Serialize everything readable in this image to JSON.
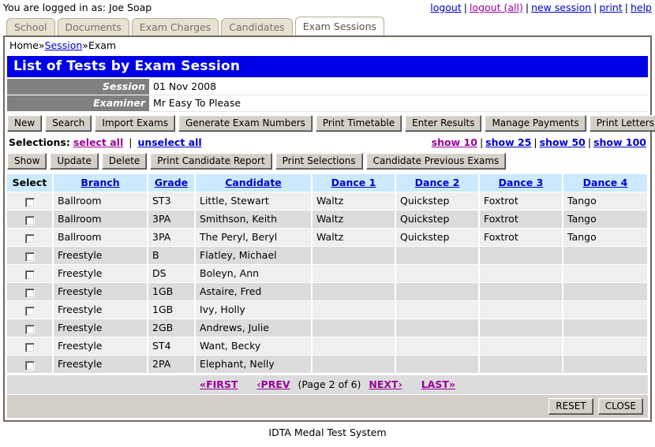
{
  "topbar": {
    "logged_in_text": "You are logged in as: Joe Soap",
    "links": [
      {
        "label": "logout",
        "visited": false
      },
      {
        "label": "logout (all)",
        "visited": true
      },
      {
        "label": "new session",
        "visited": false
      },
      {
        "label": "print",
        "visited": false
      },
      {
        "label": "help",
        "visited": false
      }
    ],
    "separator": "|"
  },
  "tabs": [
    {
      "label": "School",
      "active": false
    },
    {
      "label": "Documents",
      "active": false
    },
    {
      "label": "Exam Charges",
      "active": false
    },
    {
      "label": "Candidates",
      "active": false
    },
    {
      "label": "Exam Sessions",
      "active": true
    }
  ],
  "breadcrumb": {
    "home": "Home",
    "sep1": "»",
    "session": "Session",
    "sep2": "»",
    "exam": "Exam"
  },
  "page_title": "List of Tests by Exam Session",
  "info": [
    {
      "label": "Session",
      "value": "01 Nov 2008"
    },
    {
      "label": "Examiner",
      "value": "Mr Easy To Please"
    }
  ],
  "toolbar_primary": [
    "New",
    "Search",
    "Import Exams",
    "Generate Exam Numbers",
    "Print Timetable",
    "Enter Results",
    "Manage Payments",
    "Print Letters"
  ],
  "selections": {
    "label": "Selections:",
    "select_all": "select all",
    "unselect_all": "unselect all",
    "separator": "|",
    "show_links": [
      {
        "label": "show 10",
        "visited": true
      },
      {
        "label": "show 25",
        "visited": false
      },
      {
        "label": "show 50",
        "visited": false
      },
      {
        "label": "show 100",
        "visited": false
      }
    ]
  },
  "toolbar_secondary": [
    "Show",
    "Update",
    "Delete",
    "Print Candidate Report",
    "Print Selections",
    "Candidate Previous Exams"
  ],
  "table": {
    "columns": [
      {
        "label": "Select",
        "link": false
      },
      {
        "label": "Branch",
        "link": true
      },
      {
        "label": "Grade",
        "link": true
      },
      {
        "label": "Candidate",
        "link": true
      },
      {
        "label": "Dance 1",
        "link": true
      },
      {
        "label": "Dance 2",
        "link": true
      },
      {
        "label": "Dance 3",
        "link": true
      },
      {
        "label": "Dance 4",
        "link": true
      }
    ],
    "rows": [
      {
        "selected": false,
        "branch": "Ballroom",
        "grade": "ST3",
        "candidate": "Little, Stewart",
        "dance1": "Waltz",
        "dance2": "Quickstep",
        "dance3": "Foxtrot",
        "dance4": "Tango"
      },
      {
        "selected": false,
        "branch": "Ballroom",
        "grade": "3PA",
        "candidate": "Smithson, Keith",
        "dance1": "Waltz",
        "dance2": "Quickstep",
        "dance3": "Foxtrot",
        "dance4": "Tango"
      },
      {
        "selected": false,
        "branch": "Ballroom",
        "grade": "3PA",
        "candidate": "The Peryl, Beryl",
        "dance1": "Waltz",
        "dance2": "Quickstep",
        "dance3": "Foxtrot",
        "dance4": "Tango"
      },
      {
        "selected": false,
        "branch": "Freestyle",
        "grade": "B",
        "candidate": "Flatley, Michael",
        "dance1": "",
        "dance2": "",
        "dance3": "",
        "dance4": ""
      },
      {
        "selected": false,
        "branch": "Freestyle",
        "grade": "DS",
        "candidate": "Boleyn, Ann",
        "dance1": "",
        "dance2": "",
        "dance3": "",
        "dance4": ""
      },
      {
        "selected": false,
        "branch": "Freestyle",
        "grade": "1GB",
        "candidate": "Astaire, Fred",
        "dance1": "",
        "dance2": "",
        "dance3": "",
        "dance4": ""
      },
      {
        "selected": false,
        "branch": "Freestyle",
        "grade": "1GB",
        "candidate": "Ivy, Holly",
        "dance1": "",
        "dance2": "",
        "dance3": "",
        "dance4": ""
      },
      {
        "selected": false,
        "branch": "Freestyle",
        "grade": "2GB",
        "candidate": "Andrews, Julie",
        "dance1": "",
        "dance2": "",
        "dance3": "",
        "dance4": ""
      },
      {
        "selected": false,
        "branch": "Freestyle",
        "grade": "ST4",
        "candidate": "Want, Becky",
        "dance1": "",
        "dance2": "",
        "dance3": "",
        "dance4": ""
      },
      {
        "selected": false,
        "branch": "Freestyle",
        "grade": "2PA",
        "candidate": "Elephant, Nelly",
        "dance1": "",
        "dance2": "",
        "dance3": "",
        "dance4": ""
      }
    ]
  },
  "pager": {
    "first": "«FIRST",
    "prev": "‹PREV",
    "page_text": "(Page 2 of 6)",
    "next": "NEXT›",
    "last": "LAST»"
  },
  "footer_buttons": [
    "RESET",
    "CLOSE"
  ],
  "page_footer": "IDTA Medal Test System",
  "colors": {
    "title_bar": "#0000e6",
    "info_label_bg": "#808080",
    "table_header_bg": "#cceaff",
    "row_odd": "#efefef",
    "row_even": "#dcdcdc",
    "link": "#0000cc",
    "link_visited": "#990099",
    "button_face": "#d4d0c8",
    "tab_inactive": "#e8e2d2"
  }
}
